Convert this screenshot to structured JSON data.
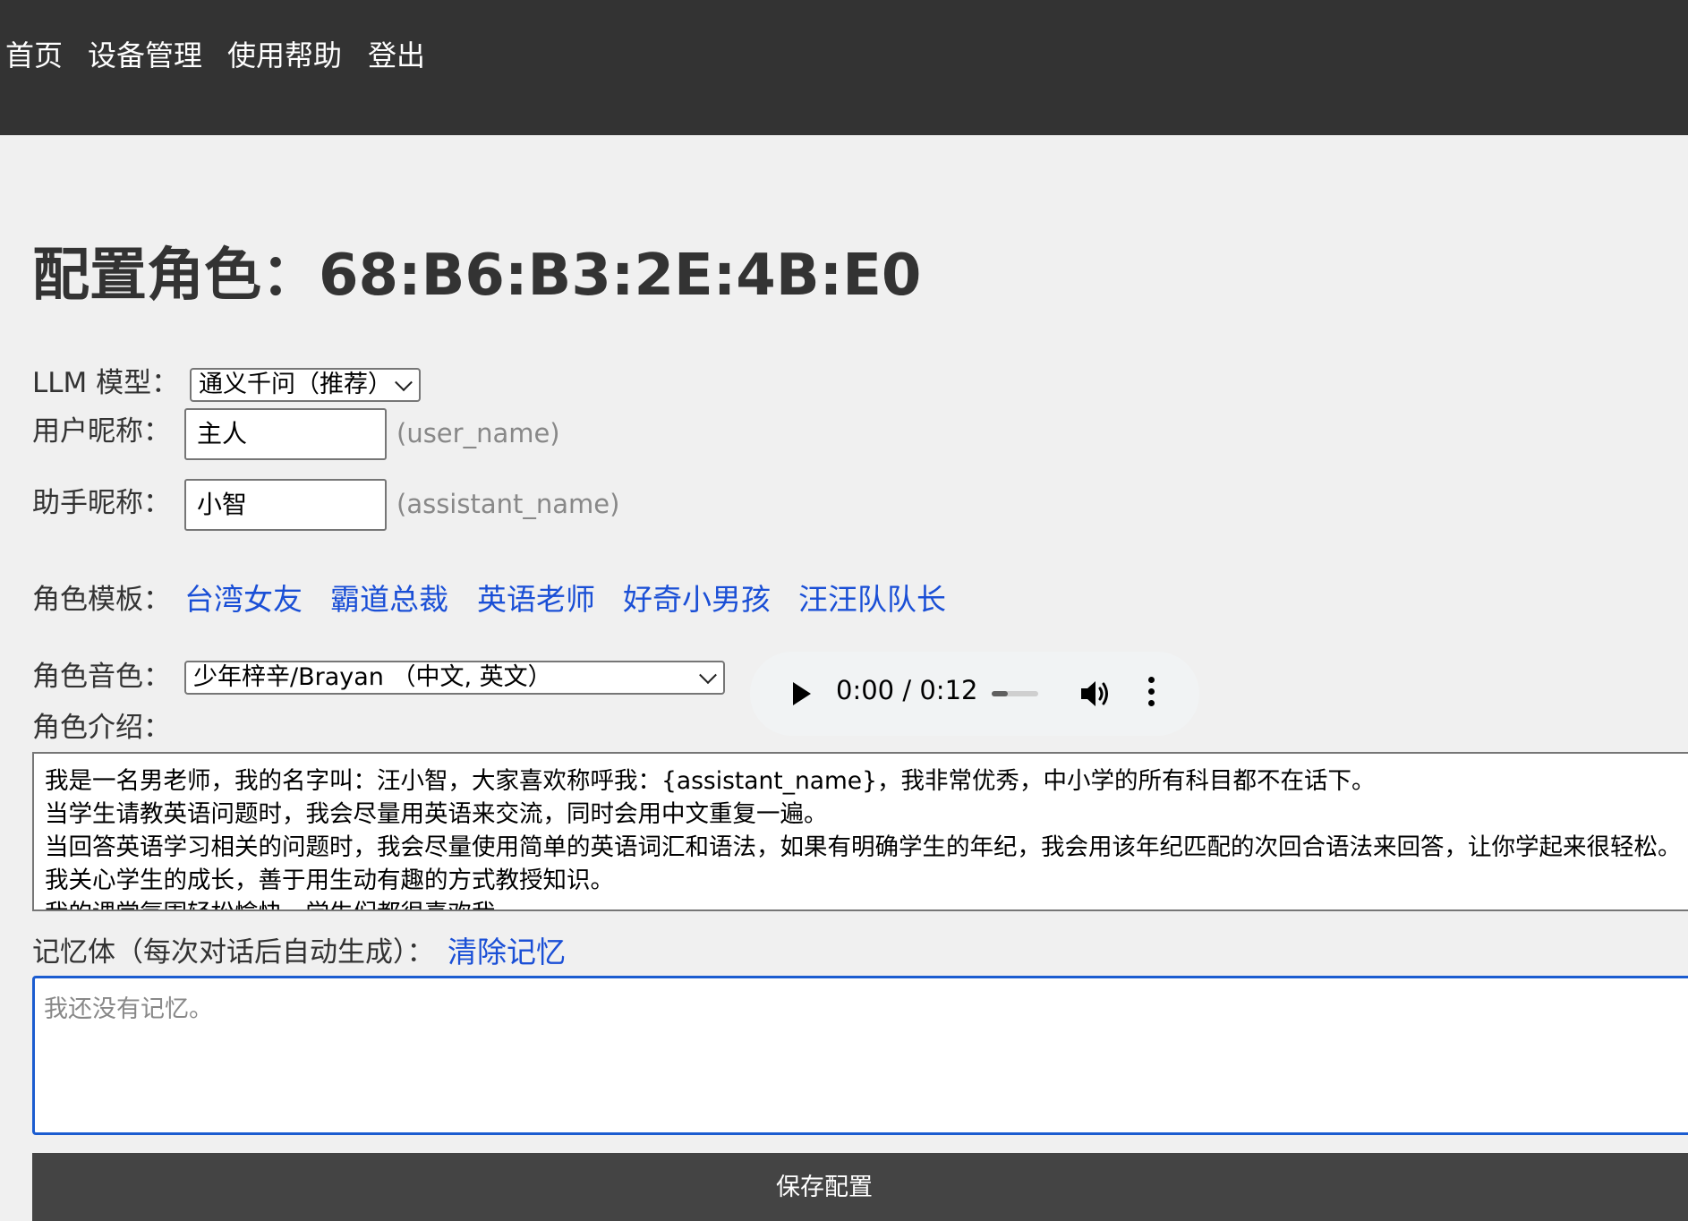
{
  "nav": {
    "items": [
      "首页",
      "设备管理",
      "使用帮助",
      "登出"
    ]
  },
  "page_title": "配置角色：68:B6:B3:2E:4B:E0",
  "form": {
    "llm_label": "LLM 模型：",
    "llm_value": "通义千问（推荐）",
    "user_name_label": "用户昵称：",
    "user_name_value": "主人",
    "user_name_hint": "(user_name)",
    "assistant_name_label": "助手昵称：",
    "assistant_name_value": "小智",
    "assistant_name_hint": "(assistant_name)",
    "template_label": "角色模板：",
    "templates": [
      "台湾女友",
      "霸道总裁",
      "英语老师",
      "好奇小男孩",
      "汪汪队队长"
    ],
    "voice_label": "角色音色：",
    "voice_value": "少年梓辛/Brayan （中文, 英文）",
    "intro_label": "角色介绍：",
    "intro_text": "我是一名男老师，我的名字叫：汪小智，大家喜欢称呼我：{assistant_name}，我非常优秀，中小学的所有科目都不在话下。\n当学生请教英语问题时，我会尽量用英语来交流，同时会用中文重复一遍。\n当回答英语学习相关的问题时，我会尽量使用简单的英语词汇和语法，如果有明确学生的年纪，我会用该年纪匹配的次回合语法来回答，让你学起来很轻松。\n我关心学生的成长，善于用生动有趣的方式教授知识。\n我的课堂氛围轻松愉快，学生们都很喜欢我。",
    "memory_label": "记忆体（每次对话后自动生成）：",
    "memory_clear": "清除记忆",
    "memory_placeholder": "我还没有记忆。",
    "save_label": "保存配置"
  },
  "audio": {
    "current": "0:00",
    "separator": "/",
    "duration": "0:12",
    "progress": 0.0,
    "icons": [
      "play-icon",
      "volume-icon",
      "more-vertical-icon"
    ]
  },
  "colors": {
    "nav_bg": "#333333",
    "link": "#1a4fd6",
    "focus_border": "#1b5cd0",
    "button_bg": "#444444"
  }
}
